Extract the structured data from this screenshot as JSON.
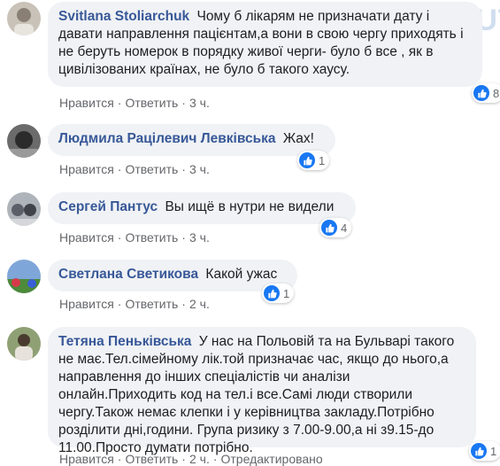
{
  "watermark": "TIMES.UT",
  "actions": {
    "like": "Нравится",
    "reply": "Ответить",
    "sep": "·",
    "edited": "Отредактировано"
  },
  "comments": [
    {
      "author": "Svitlana Stoliarchuk",
      "text": "Чому б лікарям не призначати дату і давати направлення пацієнтам,а вони в свою чергу приходять і не беруть номерок в порядку живої черги- було б все , як в цивілізованих країнах, не було б такого хаусу.",
      "time": "3 ч.",
      "likes": "8"
    },
    {
      "author": "Людмила Рацілевич Левківська",
      "text": "Жах!",
      "time": "3 ч.",
      "likes": "1"
    },
    {
      "author": "Сергей Пантус",
      "text": "Вы ищё в нутри не видели",
      "time": "3 ч.",
      "likes": "4"
    },
    {
      "author": "Светлана Светикова",
      "text": "Какой ужас",
      "time": "2 ч.",
      "likes": "1"
    },
    {
      "author": "Тетяна Пеньківська",
      "text": "У нас на Польовій та на Бульварі такого не має.Тел.сімейному лік.той призначає час, якщо до нього,а направлення до інших спеціалістів чи аналізи онлайн.Приходить код на тел.і все.Самі люди створили чергу.Також немає клепки і у керівництва закладу.Потрібно розділити дні,години. Група ризику з 7.00-9.00,а ні з9.15-до 11.00.Просто думати потрібно.",
      "time": "2 ч.",
      "likes": "1"
    }
  ]
}
